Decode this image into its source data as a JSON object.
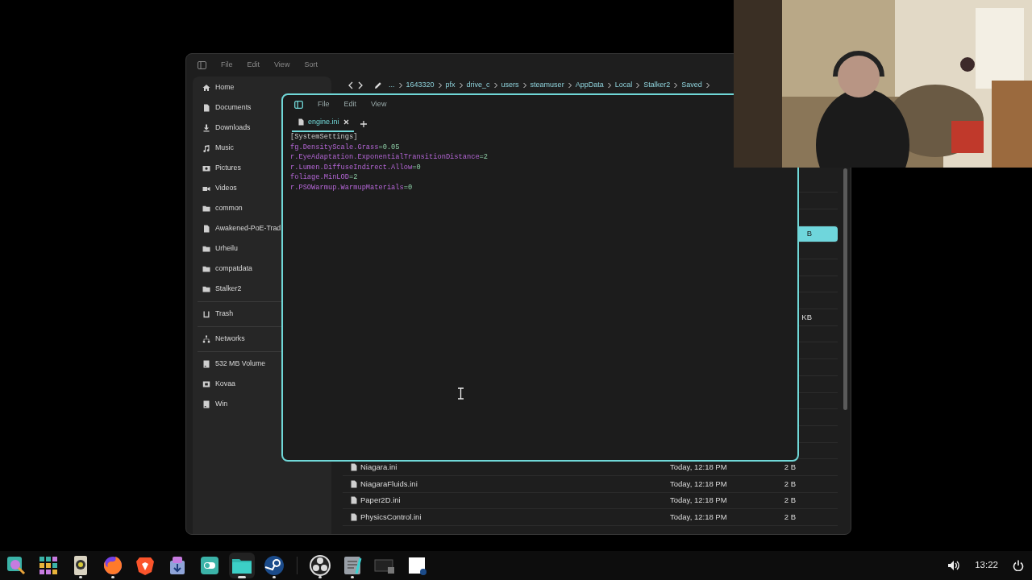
{
  "file_manager": {
    "menu": [
      "File",
      "Edit",
      "View",
      "Sort"
    ],
    "sidebar": {
      "groups": [
        {
          "items": [
            {
              "label": "Home",
              "kind": "home"
            },
            {
              "label": "Documents",
              "kind": "document"
            },
            {
              "label": "Downloads",
              "kind": "download"
            },
            {
              "label": "Music",
              "kind": "music"
            },
            {
              "label": "Pictures",
              "kind": "picture"
            },
            {
              "label": "Videos",
              "kind": "video"
            },
            {
              "label": "common",
              "kind": "folder"
            },
            {
              "label": "Awakened-PoE-Trad",
              "kind": "document"
            },
            {
              "label": "Urheilu",
              "kind": "folder"
            },
            {
              "label": "compatdata",
              "kind": "folder"
            },
            {
              "label": "Stalker2",
              "kind": "folder"
            }
          ]
        },
        {
          "items": [
            {
              "label": "Trash",
              "kind": "trash"
            }
          ]
        },
        {
          "items": [
            {
              "label": "Networks",
              "kind": "network"
            }
          ]
        },
        {
          "items": [
            {
              "label": "532 MB Volume",
              "kind": "drive"
            },
            {
              "label": "Kovaa",
              "kind": "frame"
            },
            {
              "label": "Win",
              "kind": "drive"
            }
          ]
        }
      ]
    },
    "breadcrumb": [
      "...",
      "1643320",
      "pfx",
      "drive_c",
      "users",
      "steamuser",
      "AppData",
      "Local",
      "Stalker2",
      "Saved"
    ],
    "files": [
      {
        "selected": false
      },
      {
        "selected": false
      },
      {
        "selected": false
      },
      {
        "size": "B",
        "selected": true
      },
      {
        "selected": false
      },
      {
        "selected": false
      },
      {
        "selected": false
      },
      {
        "selected": false
      },
      {
        "size": "KB",
        "selected": false
      },
      {
        "selected": false
      },
      {
        "selected": false
      },
      {
        "selected": false
      },
      {
        "selected": false
      },
      {
        "selected": false
      },
      {
        "selected": false
      },
      {
        "selected": false
      },
      {
        "selected": false
      },
      {
        "name": "Niagara.ini",
        "modified": "Today, 12:18 PM",
        "size": "2 B",
        "selected": false
      },
      {
        "name": "NiagaraFluids.ini",
        "modified": "Today, 12:18 PM",
        "size": "2 B",
        "selected": false
      },
      {
        "name": "Paper2D.ini",
        "modified": "Today, 12:18 PM",
        "size": "2 B",
        "selected": false
      },
      {
        "name": "PhysicsControl.ini",
        "modified": "Today, 12:18 PM",
        "size": "2 B",
        "selected": false
      }
    ]
  },
  "editor": {
    "menu": [
      "File",
      "Edit",
      "View"
    ],
    "tabs": [
      {
        "label": "engine.ini",
        "selected": true
      }
    ],
    "lines": [
      {
        "kind": "section",
        "text": "[SystemSettings]"
      },
      {
        "kind": "setting",
        "key": "fg.DensityScale.Grass",
        "value": "=0.05"
      },
      {
        "kind": "setting",
        "key": "r.EyeAdaptation.ExponentialTransitionDistance",
        "value": "=2"
      },
      {
        "kind": "setting",
        "key": "r.Lumen.DiffuseIndirect.Allow",
        "value": "=0"
      },
      {
        "kind": "setting",
        "key": "foliage.MinLOD",
        "value": "=2"
      },
      {
        "kind": "setting",
        "key": "r.PSOWarmup.WarmupMaterials",
        "value": "=0"
      }
    ]
  },
  "taskbar": {
    "apps": [
      {
        "kind": "search",
        "running": false,
        "active": false
      },
      {
        "kind": "grid",
        "running": false,
        "active": false
      },
      {
        "kind": "speaker",
        "running": true,
        "active": false
      },
      {
        "kind": "fox",
        "running": true,
        "active": false
      },
      {
        "kind": "lion",
        "running": false,
        "active": false
      },
      {
        "kind": "package",
        "running": false,
        "active": false
      },
      {
        "kind": "toggle",
        "running": false,
        "active": false
      },
      {
        "kind": "folder",
        "running": true,
        "active": true
      },
      {
        "kind": "steam",
        "running": true,
        "active": false
      },
      {
        "kind": "separator"
      },
      {
        "kind": "ring",
        "running": true,
        "active": false
      },
      {
        "kind": "notepad",
        "running": true,
        "active": false
      },
      {
        "kind": "terminal",
        "running": false,
        "active": false
      },
      {
        "kind": "window",
        "running": false,
        "active": false
      }
    ],
    "clock": "13:22"
  }
}
